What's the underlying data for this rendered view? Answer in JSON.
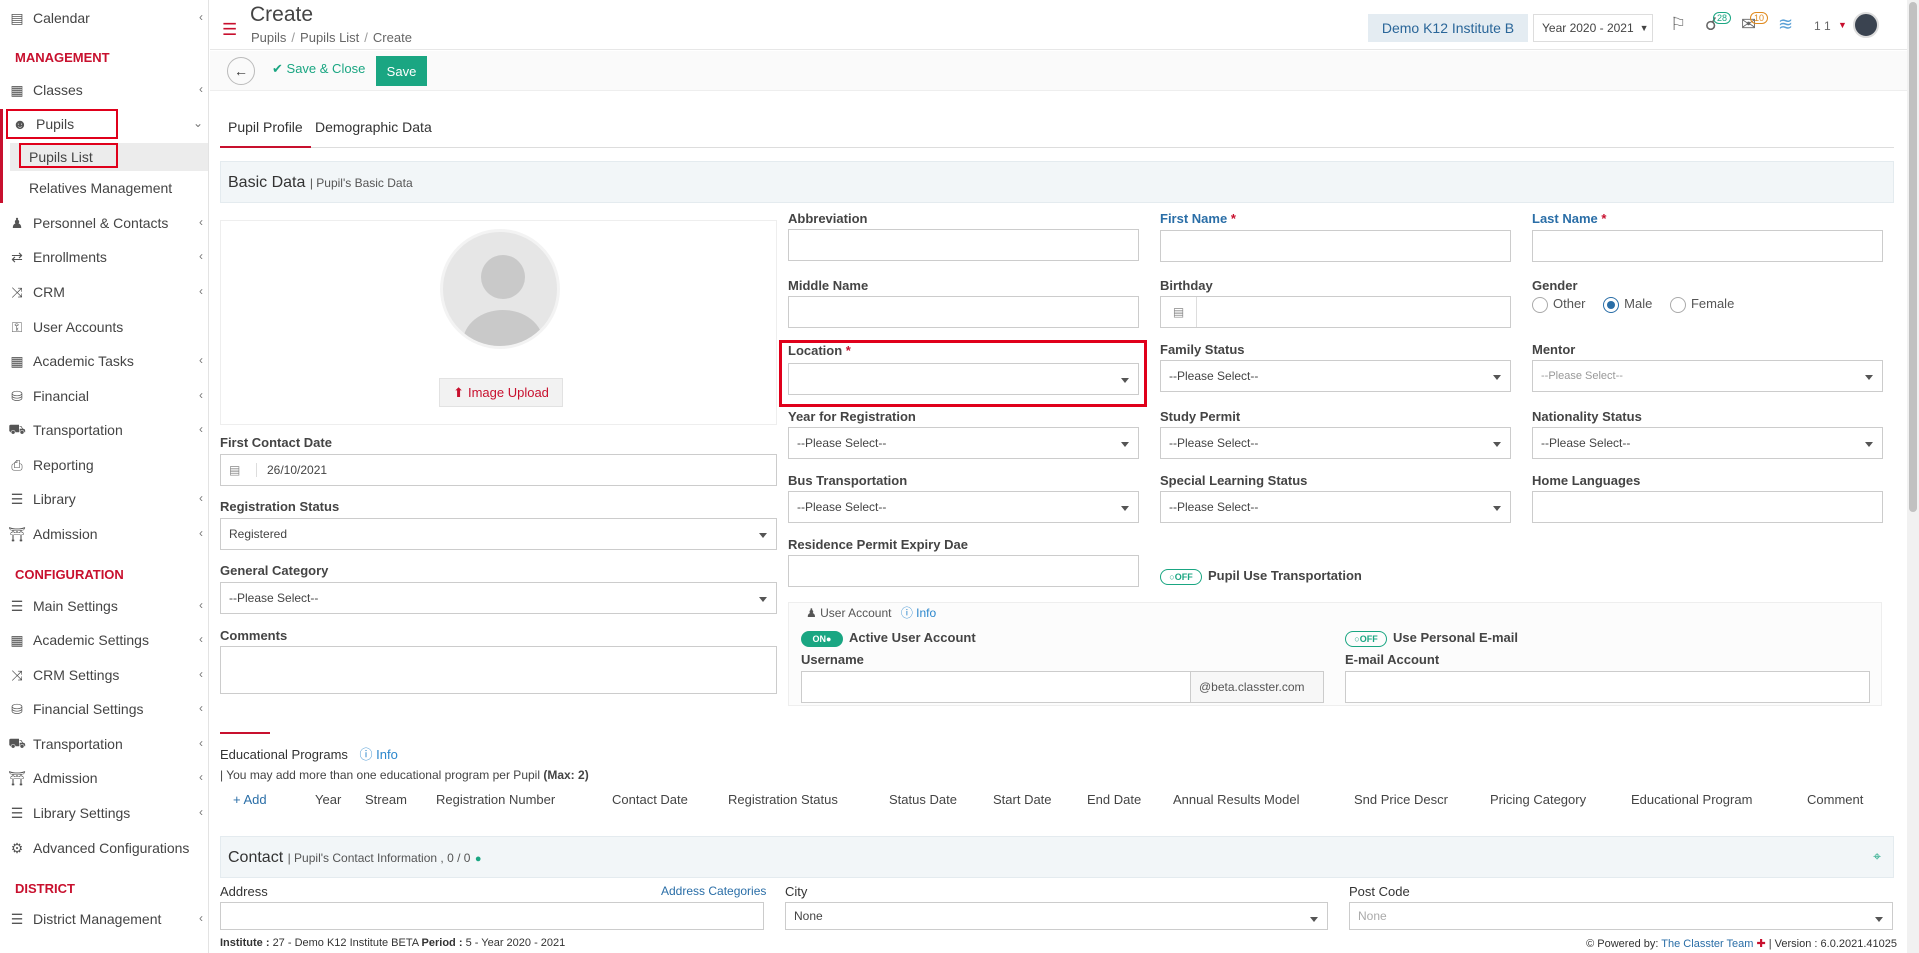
{
  "sidebar": {
    "calendar": "Calendar",
    "management_heading": "MANAGEMENT",
    "classes": "Classes",
    "pupils": "Pupils",
    "pupils_list": "Pupils List",
    "relatives": "Relatives Management",
    "personnel": "Personnel & Contacts",
    "enrollments": "Enrollments",
    "crm": "CRM",
    "user_accounts": "User Accounts",
    "academic_tasks": "Academic Tasks",
    "financial": "Financial",
    "transportation": "Transportation",
    "reporting": "Reporting",
    "library": "Library",
    "admission": "Admission",
    "configuration_heading": "CONFIGURATION",
    "main_settings": "Main Settings",
    "academic_settings": "Academic Settings",
    "crm_settings": "CRM Settings",
    "financial_settings": "Financial Settings",
    "transportation2": "Transportation",
    "admission2": "Admission",
    "library_settings": "Library Settings",
    "advanced_config": "Advanced Configurations",
    "district_heading": "DISTRICT",
    "district_mgmt": "District Management"
  },
  "header": {
    "title": "Create",
    "breadcrumb": [
      "Pupils",
      "Pupils List",
      "Create"
    ],
    "institute": "Demo K12 Institute B",
    "year": "Year 2020 - 2021",
    "notif_count": "28",
    "mail_count": "10",
    "user_short": "1 1"
  },
  "toolbar": {
    "save_close": "Save & Close",
    "save": "Save"
  },
  "tabs": {
    "profile": "Pupil Profile",
    "demographic": "Demographic Data"
  },
  "basic": {
    "title": "Basic Data",
    "subtitle": "| Pupil's Basic Data",
    "image_upload": "Image Upload",
    "first_contact_label": "First Contact Date",
    "first_contact_value": "26/10/2021",
    "reg_status_label": "Registration Status",
    "reg_status_value": "Registered",
    "general_cat_label": "General Category",
    "general_cat_value": "--Please Select--",
    "comments_label": "Comments",
    "abbreviation": "Abbreviation",
    "first_name": "First Name",
    "last_name": "Last Name",
    "middle_name": "Middle Name",
    "birthday": "Birthday",
    "gender": "Gender",
    "gender_options": [
      "Other",
      "Male",
      "Female"
    ],
    "location": "Location",
    "family_status": "Family Status",
    "mentor": "Mentor",
    "year_reg": "Year for Registration",
    "study_permit": "Study Permit",
    "nationality": "Nationality Status",
    "bus": "Bus Transportation",
    "special_learning": "Special Learning Status",
    "home_languages": "Home Languages",
    "residence_permit": "Residence Permit Expiry Dae",
    "pupil_transport": "Pupil Use Transportation",
    "please_select": "--Please Select--",
    "required_mark": "*"
  },
  "user_account": {
    "title": "User Account",
    "info": "Info",
    "active": "Active User Account",
    "personal_email": "Use Personal E-mail",
    "username": "Username",
    "domain": "@beta.classter.com",
    "email": "E-mail Account",
    "on": "ON",
    "off": "OFF"
  },
  "edu": {
    "title": "Educational Programs",
    "info": "Info",
    "note_prefix": "| You may add more than one educational program per Pupil",
    "note_max": "(Max: 2)",
    "add": "Add",
    "columns": [
      "Year",
      "Stream",
      "Registration Number",
      "Contact Date",
      "Registration Status",
      "Status Date",
      "Start Date",
      "End Date",
      "Annual Results Model",
      "Snd Price Descr",
      "Pricing Category",
      "Educational Program",
      "Comment"
    ]
  },
  "contact": {
    "title": "Contact",
    "subtitle": "| Pupil's Contact Information , 0 / 0",
    "address": "Address",
    "address_cat": "Address Categories",
    "city": "City",
    "city_value": "None",
    "post_code": "Post Code",
    "post_value": "None"
  },
  "footer": {
    "institute_label": "Institute :",
    "institute_value": "27 - Demo K12 Institute BETA",
    "period_label": "Period :",
    "period_value": "5 - Year 2020 - 2021",
    "powered": "Powered by:",
    "team": "The Classter Team",
    "version": "| Version : 6.0.2021.41025"
  }
}
